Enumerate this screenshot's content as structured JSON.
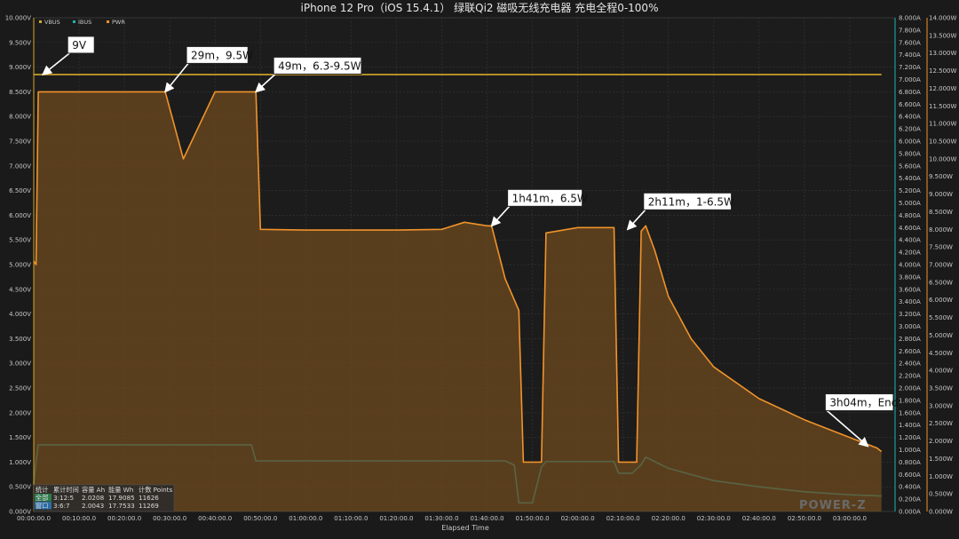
{
  "chart_data": {
    "type": "line",
    "title": "iPhone 12 Pro（iOS 15.4.1） 绿联Qi2 磁吸无线充电器 充电全程0-100%",
    "xlabel": "Elapsed Time",
    "x_unit": "minutes",
    "xlim": [
      0,
      190
    ],
    "x_ticks": [
      "00:00:00.0",
      "00:10:00.0",
      "00:20:00.0",
      "00:30:00.0",
      "00:40:00.0",
      "00:50:00.0",
      "01:00:00.0",
      "01:10:00.0",
      "01:20:00.0",
      "01:30:00.0",
      "01:40:00.0",
      "01:50:00.0",
      "02:00:00.0",
      "02:10:00.0",
      "02:20:00.0",
      "02:30:00.0",
      "02:40:00.0",
      "02:50:00.0",
      "03:00:00.0"
    ],
    "y_left": {
      "range": [
        0,
        10
      ],
      "unit": "V",
      "ticks": [
        "0.000V",
        "0.500V",
        "1.000V",
        "1.500V",
        "2.000V",
        "2.500V",
        "3.000V",
        "3.500V",
        "4.000V",
        "4.500V",
        "5.000V",
        "5.500V",
        "6.000V",
        "6.500V",
        "7.000V",
        "7.500V",
        "8.000V",
        "8.500V",
        "9.000V",
        "9.500V",
        "10.000V"
      ]
    },
    "y_right_current": {
      "range": [
        0,
        8
      ],
      "unit": "A",
      "ticks": [
        "0.000A",
        "0.200A",
        "0.400A",
        "0.600A",
        "0.800A",
        "1.000A",
        "1.200A",
        "1.400A",
        "1.600A",
        "1.800A",
        "2.000A",
        "2.200A",
        "2.400A",
        "2.600A",
        "2.800A",
        "3.000A",
        "3.200A",
        "3.400A",
        "3.600A",
        "3.800A",
        "4.000A",
        "4.200A",
        "4.400A",
        "4.600A",
        "4.800A",
        "5.000A",
        "5.200A",
        "5.400A",
        "5.600A",
        "5.800A",
        "6.000A",
        "6.200A",
        "6.400A",
        "6.600A",
        "6.800A",
        "7.000A",
        "7.200A",
        "7.400A",
        "7.600A",
        "7.800A",
        "8.000A"
      ]
    },
    "y_right_power": {
      "range": [
        0,
        14
      ],
      "unit": "W",
      "ticks": [
        "0.000W",
        "0.500W",
        "1.000W",
        "1.500W",
        "2.000W",
        "2.500W",
        "3.000W",
        "3.500W",
        "4.000W",
        "4.500W",
        "5.000W",
        "5.500W",
        "6.000W",
        "6.500W",
        "7.000W",
        "7.500W",
        "8.000W",
        "8.500W",
        "9.000W",
        "9.500W",
        "10.000W",
        "10.500W",
        "11.000W",
        "11.500W",
        "12.000W",
        "12.500W",
        "13.000W",
        "13.500W",
        "14.000W"
      ]
    },
    "legend": [
      "VBUS",
      "IBUS",
      "PWR"
    ],
    "legend_position": "top-left",
    "grid": true,
    "colors": {
      "VBUS": "#d4a72c",
      "IBUS": "#19b5b0",
      "PWR": "#f0932b",
      "pwr_fill": "#6e4a1f",
      "background": "#1a1a1a"
    },
    "series": [
      {
        "name": "VBUS",
        "unit": "V",
        "x": [
          0,
          10,
          30,
          60,
          90,
          120,
          150,
          180,
          187
        ],
        "values": [
          8.85,
          8.85,
          8.85,
          8.85,
          8.85,
          8.85,
          8.85,
          8.85,
          8.85
        ]
      },
      {
        "name": "IBUS",
        "unit": "A",
        "x": [
          0,
          0.5,
          1,
          10,
          20,
          30,
          48,
          49,
          60,
          90,
          104,
          106,
          107,
          110,
          112,
          113,
          120,
          128,
          129,
          132,
          134,
          135,
          140,
          150,
          160,
          170,
          180,
          187
        ],
        "values": [
          0.45,
          0.8,
          1.08,
          1.08,
          1.08,
          1.08,
          1.08,
          0.82,
          0.82,
          0.82,
          0.82,
          0.75,
          0.14,
          0.14,
          0.72,
          0.81,
          0.81,
          0.81,
          0.62,
          0.62,
          0.76,
          0.88,
          0.7,
          0.5,
          0.4,
          0.32,
          0.27,
          0.25
        ]
      },
      {
        "name": "PWR",
        "unit": "W",
        "x": [
          0,
          0.5,
          1,
          5,
          10,
          20,
          29,
          33,
          40,
          45,
          49,
          50,
          60,
          70,
          80,
          90,
          95,
          100,
          101,
          104,
          107,
          108,
          110,
          112,
          113,
          120,
          128,
          129,
          131,
          133,
          134,
          135,
          137,
          140,
          145,
          150,
          160,
          170,
          180,
          186,
          187
        ],
        "values": [
          7.1,
          7.0,
          11.9,
          11.9,
          11.9,
          11.9,
          11.9,
          10.0,
          11.9,
          11.9,
          11.9,
          8.0,
          7.98,
          7.98,
          7.98,
          8.0,
          8.2,
          8.1,
          8.1,
          6.6,
          5.7,
          1.4,
          1.4,
          1.4,
          7.9,
          8.05,
          8.05,
          1.4,
          1.4,
          1.4,
          7.95,
          8.1,
          7.4,
          6.1,
          4.9,
          4.1,
          3.2,
          2.6,
          2.1,
          1.8,
          1.7
        ]
      }
    ],
    "annotations": [
      {
        "text": "9V",
        "x": 2,
        "y": 8.85,
        "axis": "V"
      },
      {
        "text": "29m，9.5W",
        "x": 29,
        "y": 11.9,
        "axis": "W"
      },
      {
        "text": "49m，6.3-9.5W",
        "x": 49,
        "y": 11.9,
        "axis": "W"
      },
      {
        "text": "1h41m，6.5W",
        "x": 101,
        "y": 8.1,
        "axis": "W"
      },
      {
        "text": "2h11m，1-6.5W",
        "x": 131,
        "y": 8.0,
        "axis": "W"
      },
      {
        "text": "3h04m，End",
        "x": 184,
        "y": 1.85,
        "axis": "W"
      }
    ]
  },
  "stats_table": {
    "headers": [
      "统计",
      "累计时间",
      "容量 Ah",
      "能量 Wh",
      "计数 Points"
    ],
    "rows": [
      [
        "全部",
        "3:12:5",
        "2.0208",
        "17.9085",
        "11626"
      ],
      [
        "窗口",
        "3:6:7",
        "2.0043",
        "17.7533",
        "11269"
      ]
    ]
  },
  "watermark": "POWER-Z"
}
